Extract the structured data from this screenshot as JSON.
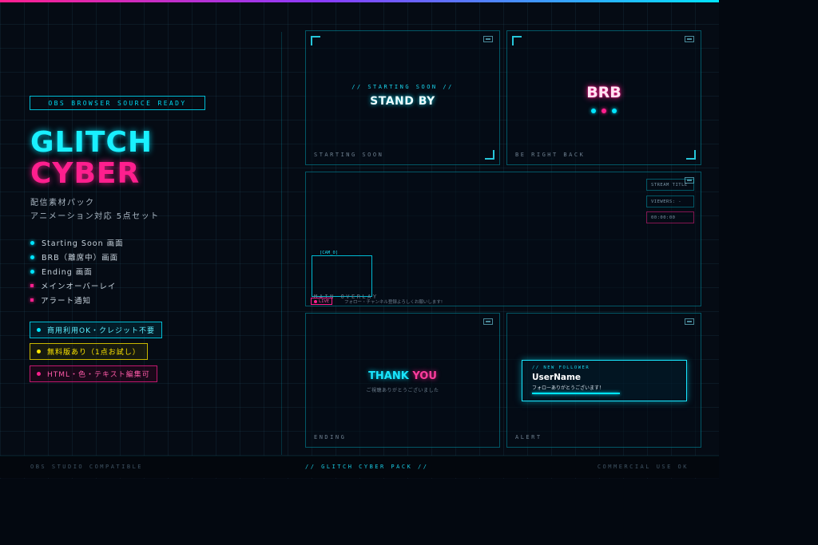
{
  "tagline": "OBS BROWSER SOURCE READY",
  "title_line1": "GLITCH",
  "title_line2": "CYBER",
  "subtitle1": "配信素材パック",
  "subtitle2": "アニメーション対応 5点セット",
  "features": [
    {
      "label": "Starting Soon 画面",
      "color": "#00e5ff"
    },
    {
      "label": "BRB（離席中）画面",
      "color": "#00e5ff"
    },
    {
      "label": "Ending 画面",
      "color": "#00e5ff"
    },
    {
      "label": "メインオーバーレイ",
      "color": "#ff1f8e"
    },
    {
      "label": "アラート通知",
      "color": "#ff1f8e"
    }
  ],
  "chips": [
    {
      "label": "商用利用OK・クレジット不要",
      "color": "#00e5ff"
    },
    {
      "label": "無料版あり（1点お試し）",
      "color": "#ffe600"
    },
    {
      "label": "HTML・色・テキスト編集可",
      "color": "#ff1f8e"
    }
  ],
  "starting": {
    "head": "// STARTING SOON //",
    "title": "STAND BY",
    "label": "STARTING SOON"
  },
  "brb": {
    "title": "BRB",
    "label": "BE RIGHT BACK",
    "dot_colors": [
      "#00e5ff",
      "#ff1f8e",
      "#00e5ff"
    ]
  },
  "main_overlay": {
    "hud_title": "STREAM TITLE",
    "hud_viewers": "VIEWERS: -",
    "hud_time": "00:00:00",
    "cam_tag": "[CAM_0]",
    "live": "LIVE",
    "ticker": "フォロー・チャンネル登録よろしくお願いします!",
    "label": "MAIN OVERLAY"
  },
  "ending": {
    "word1": "THANK",
    "word2": "YOU",
    "sub": "ご視聴ありがとうございました",
    "label": "ENDING"
  },
  "alert": {
    "head": "// NEW FOLLOWER",
    "user": "UserName",
    "message": "フォローありがとうございます！",
    "label": "ALERT"
  },
  "footer": {
    "left": "OBS STUDIO COMPATIBLE",
    "center": "// GLITCH CYBER PACK //",
    "right": "COMMERCIAL USE OK"
  },
  "colors": {
    "cyan": "#00e5ff",
    "pink": "#ff1f8e",
    "yellow": "#ffe600"
  }
}
